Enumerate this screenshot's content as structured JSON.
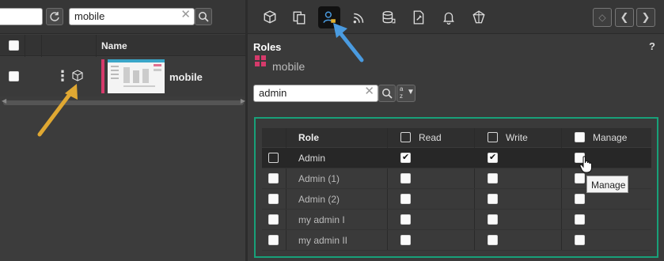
{
  "left": {
    "search_value": "mobile",
    "grid": {
      "column_name": "Name",
      "row": {
        "name": "mobile"
      }
    }
  },
  "right": {
    "section_title": "Roles",
    "entity_name": "mobile",
    "role_search_value": "admin",
    "sort_label_top": "a",
    "sort_label_bottom": "z",
    "help": "?",
    "table": {
      "headers": {
        "role": "Role",
        "read": "Read",
        "write": "Write",
        "manage": "Manage"
      },
      "rows": [
        {
          "role": "Admin",
          "read": true,
          "write": true,
          "manage": false
        },
        {
          "role": "Admin (1)",
          "read": false,
          "write": false,
          "manage": false
        },
        {
          "role": "Admin (2)",
          "read": false,
          "write": false,
          "manage": false
        },
        {
          "role": "my admin I",
          "read": false,
          "write": false,
          "manage": false
        },
        {
          "role": "my admin II",
          "read": false,
          "write": false,
          "manage": false
        }
      ]
    },
    "tooltip": "Manage"
  },
  "colors": {
    "accent_outline": "#18a079",
    "brand_pink": "#d63a6b",
    "callout_blue": "#4a9be0",
    "callout_yellow": "#e0a832"
  }
}
